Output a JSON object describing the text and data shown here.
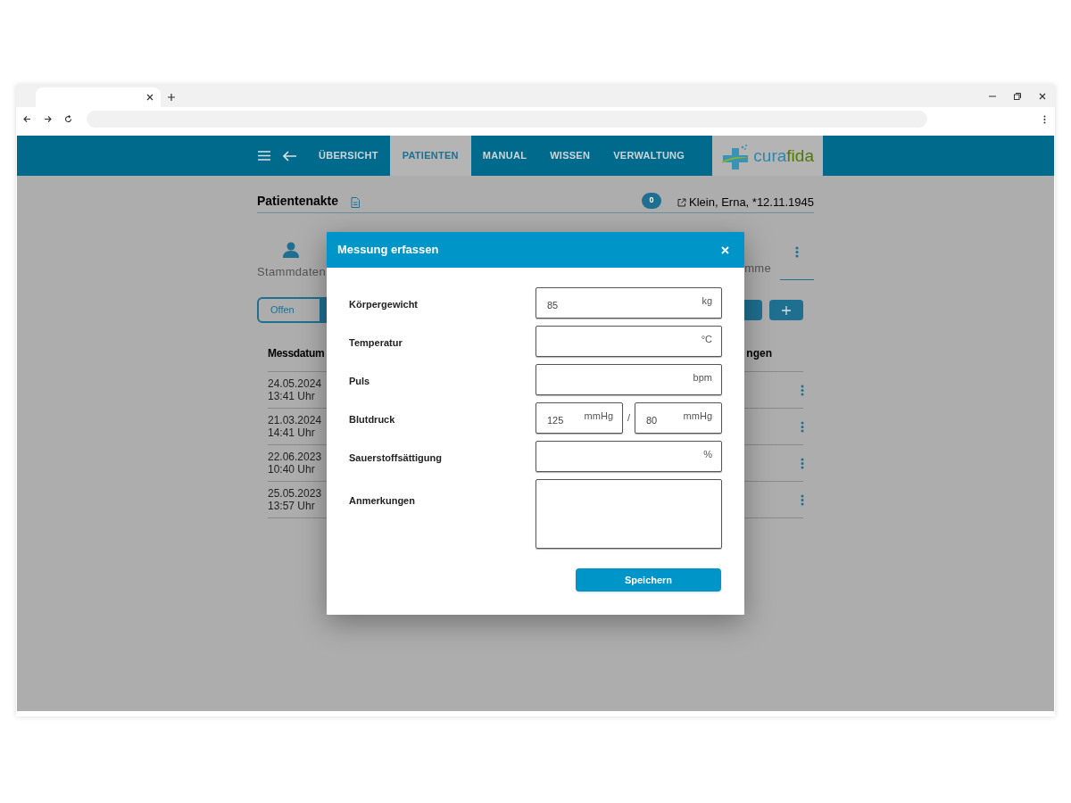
{
  "nav": {
    "items": [
      {
        "label": "ÜBERSICHT",
        "selected": false
      },
      {
        "label": "PATIENTEN",
        "selected": true
      },
      {
        "label": "MANUAL",
        "selected": false
      },
      {
        "label": "WISSEN",
        "selected": false
      },
      {
        "label": "VERWALTUNG",
        "selected": false
      }
    ]
  },
  "logo": {
    "part_1": "cura",
    "part_2": "fida"
  },
  "record": {
    "title": "Patientenakte",
    "message_count": "0",
    "patient": "Klein, Erna, *12.11.1945"
  },
  "sections": [
    {
      "label": "Stammdaten"
    },
    {
      "label": "mme"
    }
  ],
  "filter": {
    "label": "Offen"
  },
  "table": {
    "columns": [
      "Messdatum",
      "ngen"
    ],
    "rows": [
      {
        "date": "24.05.2024",
        "time": "13:41 Uhr"
      },
      {
        "date": "21.03.2024",
        "time": "14:41 Uhr"
      },
      {
        "date": "22.06.2023",
        "time": "10:40 Uhr"
      },
      {
        "date": "25.05.2023",
        "time": "13:57 Uhr"
      }
    ]
  },
  "dialog": {
    "title": "Messung erfassen",
    "fields": [
      {
        "kind": "single",
        "label": "Körpergewicht",
        "value": "85",
        "unit": "kg"
      },
      {
        "kind": "single",
        "label": "Temperatur",
        "unit": "°C"
      },
      {
        "kind": "single",
        "label": "Puls",
        "unit": "bpm"
      },
      {
        "kind": "pair",
        "label": "Blutdruck",
        "separator": "/",
        "parts": [
          {
            "value": "125",
            "unit": "mmHg"
          },
          {
            "value": "80",
            "unit": "mmHg"
          }
        ]
      },
      {
        "kind": "single",
        "label": "Sauerstoffsättigung",
        "unit": "%"
      },
      {
        "kind": "textarea",
        "label": "Anmerkungen"
      }
    ],
    "save": "Speichern"
  }
}
